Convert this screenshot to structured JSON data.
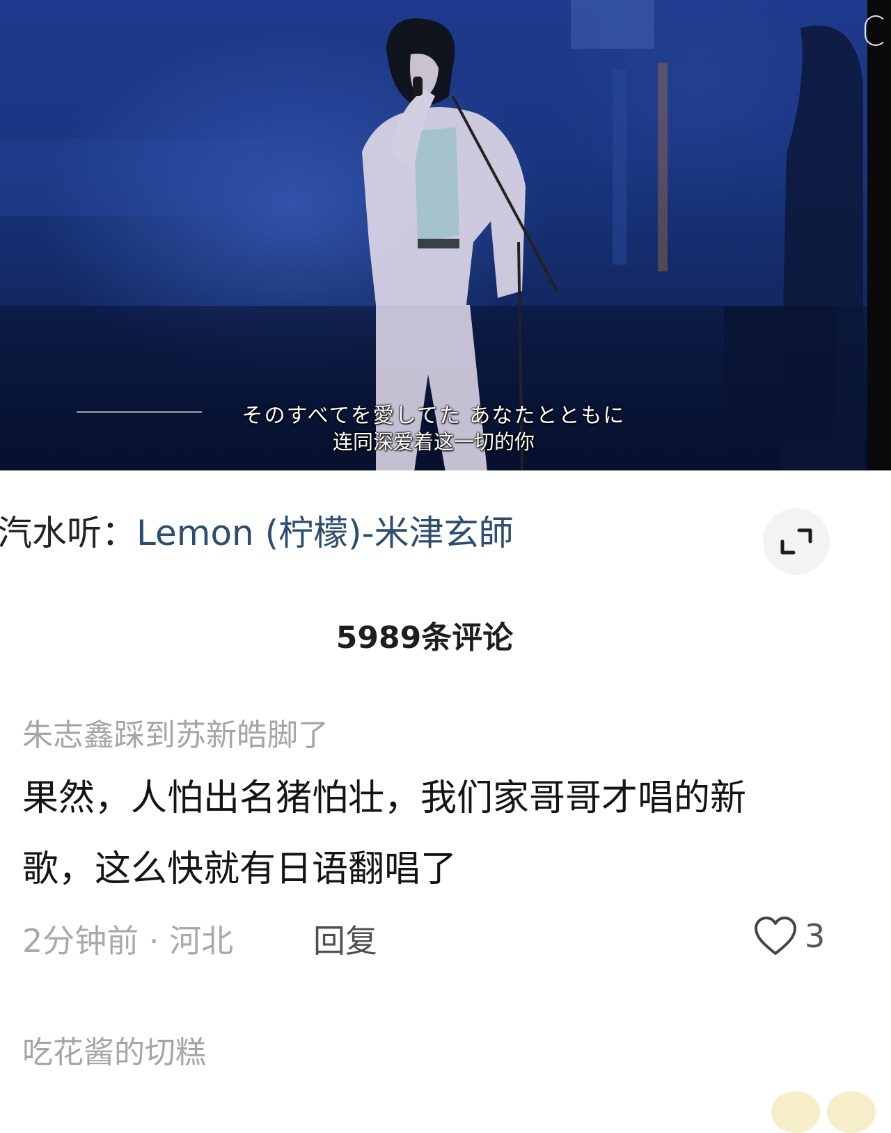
{
  "video": {
    "subtitle_jp": "そのすべてを愛してた あなたとともに",
    "subtitle_cn": "连同深爱着这一切的你"
  },
  "music": {
    "prefix": "汽水听：",
    "title": "Lemon (柠檬)-米津玄師",
    "expand_icon": "expand-corners-icon"
  },
  "comments_header": {
    "count_label": "5989条评论"
  },
  "comments": [
    {
      "username": "朱志鑫踩到苏新皓脚了",
      "line1": "果然，人怕出名猪怕壮，我们家哥哥才唱的新",
      "line2": "歌，这么快就有日语翻唱了",
      "meta": "2分钟前 · 河北",
      "reply_label": "回复",
      "likes": "3",
      "like_icon": "heart-outline-icon"
    },
    {
      "username": "吃花酱的切糕"
    }
  ],
  "colors": {
    "music_title": "#2d4d6e",
    "username": "#a5a5a5",
    "body_text": "#141414",
    "video_bg": "#1a3580"
  }
}
